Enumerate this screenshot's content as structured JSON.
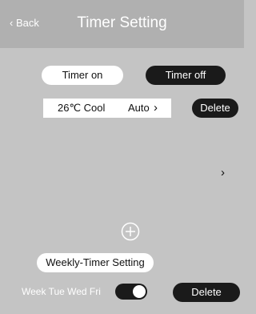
{
  "header": {
    "back_label": "Back",
    "back_icon": "‹",
    "title": "Timer Setting"
  },
  "tabs": {
    "timer_on": "Timer on",
    "timer_off": "Timer off",
    "selected": "Timer off"
  },
  "timer_entry": {
    "temperature": "26℃ Cool",
    "mode": "Auto",
    "chevron": "›",
    "delete_label": "Delete"
  },
  "empty_row": {
    "chevron": "›"
  },
  "add_icon": "circle-plus-icon",
  "weekly": {
    "button_label": "Weekly-Timer Setting",
    "days_label": "Week Tue Wed Fri",
    "toggle_on": true,
    "delete_label": "Delete"
  }
}
